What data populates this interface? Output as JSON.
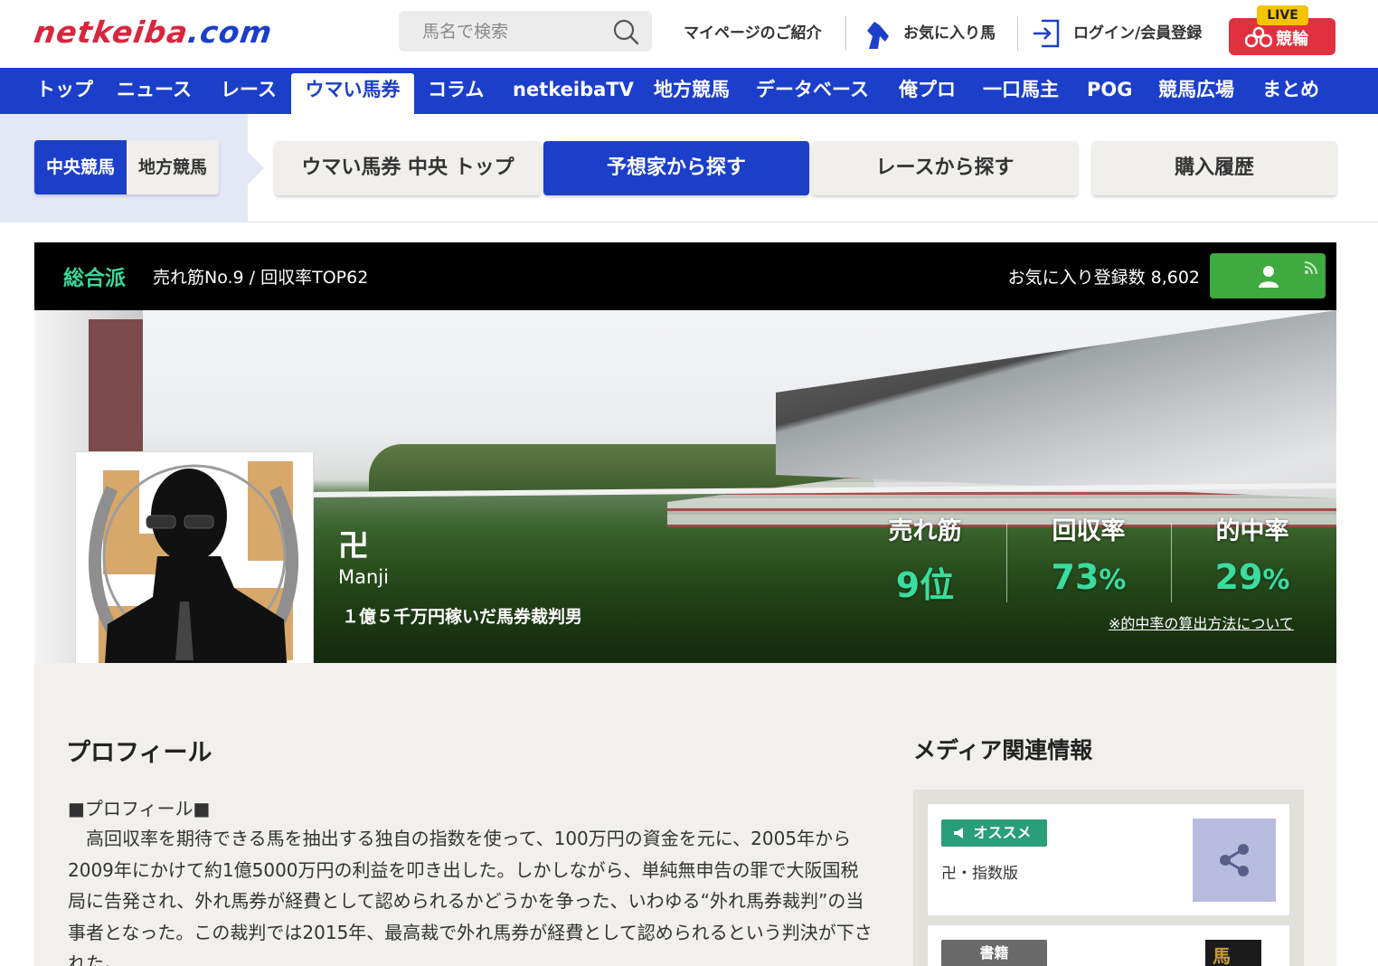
{
  "header": {
    "logo": "netkeiba",
    "logo_suffix": ".com",
    "search_placeholder": "馬名で検索",
    "links": {
      "mypage": "マイページのご紹介",
      "favorites": "お気に入り馬",
      "login": "ログイン/会員登録"
    },
    "keirin": {
      "live": "LIVE",
      "label": "競輪"
    }
  },
  "nav": {
    "items": [
      "トップ",
      "ニュース",
      "レース",
      "ウマい馬券",
      "コラム",
      "netkeibaTV",
      "地方競馬",
      "データベース",
      "俺プロ",
      "一口馬主",
      "POG",
      "競馬広場",
      "まとめ"
    ],
    "active_index": 3
  },
  "subnav": {
    "toggle": {
      "on": "中央競馬",
      "off": "地方競馬"
    },
    "tabs": [
      "ウマい馬券 中央 トップ",
      "予想家から探す",
      "レースから探す",
      "購入履歴"
    ],
    "active_tab": 1
  },
  "profile_bar": {
    "type": "総合派",
    "stats": "売れ筋No.9 / 回収率TOP62",
    "favorites": "お気に入り登録数 8,602"
  },
  "predictor": {
    "name_jp": "卍",
    "name_en": "Manji",
    "tagline": "１億５千万円稼いだ馬券裁判男",
    "stats": [
      {
        "label": "売れ筋",
        "value": "9",
        "unit": "位"
      },
      {
        "label": "回収率",
        "value": "73",
        "unit": "%"
      },
      {
        "label": "的中率",
        "value": "29",
        "unit": "%"
      }
    ],
    "note_link": "※的中率の算出方法について"
  },
  "profile": {
    "heading": "プロフィール",
    "title": "■プロフィール■",
    "body": "　高回収率を期待できる馬を抽出する独自の指数を使って、100万円の資金を元に、2005年から2009年にかけて約1億5000万円の利益を叩き出した。しかしながら、単純無申告の罪で大阪国税局に告発され、外れ馬券が経費として認められるかどうかを争った、いわゆる“外れ馬券裁判”の当事者となった。この裁判では2015年、最高裁で外れ馬券が経費として認められるという判決が下された。"
  },
  "media": {
    "heading": "メディア関連情報",
    "cards": [
      {
        "badge": "オススメ",
        "title": "卍・指数版"
      },
      {
        "badge": "書籍",
        "cover": "馬"
      }
    ]
  },
  "colors": {
    "brand_blue": "#1c3fc9",
    "brand_red": "#d7263d",
    "stat_green": "#3bdc9f",
    "fav_green": "#3faa3f"
  }
}
